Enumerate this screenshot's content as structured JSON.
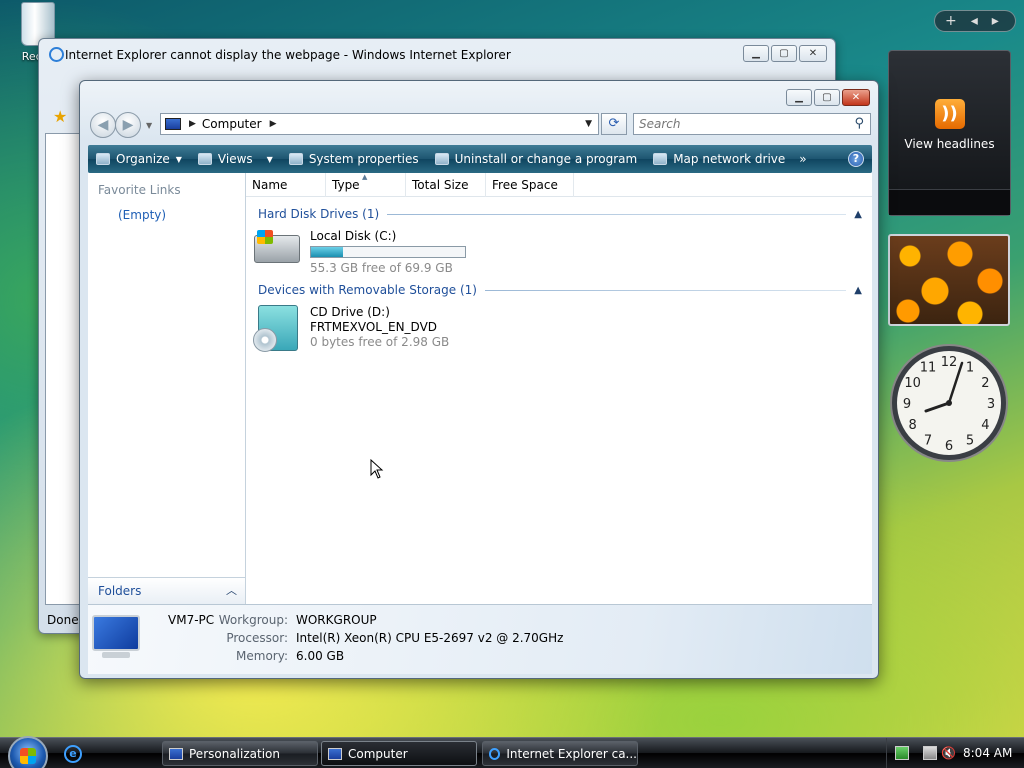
{
  "desktop": {
    "recycle_bin_label": "Recyc"
  },
  "sidebar": {
    "controls": [
      "+",
      "◂",
      "▸"
    ],
    "feed_gadget_label": "View headlines",
    "clock_numbers": [
      "12",
      "1",
      "2",
      "3",
      "4",
      "5",
      "6",
      "7",
      "8",
      "9",
      "10",
      "11"
    ]
  },
  "ie_window": {
    "title": "Internet Explorer cannot display the webpage - Windows Internet Explorer",
    "status": "Done"
  },
  "explorer": {
    "address": "Computer",
    "search_placeholder": "Search",
    "commands": [
      "Organize",
      "Views",
      "System properties",
      "Uninstall or change a program",
      "Map network drive"
    ],
    "more": "»",
    "help": "?",
    "favorite_links": "Favorite Links",
    "favorite_empty": "(Empty)",
    "folders": "Folders",
    "columns": [
      "Name",
      "Type",
      "Total Size",
      "Free Space"
    ],
    "groups": [
      {
        "title": "Hard Disk Drives (1)",
        "drive_name": "Local Disk (C:)",
        "drive_space": "55.3 GB free of 69.9 GB",
        "used_fraction": 0.21
      },
      {
        "title": "Devices with Removable Storage (1)",
        "drive_name": "CD Drive (D:)",
        "drive_label": "FRTMEXVOL_EN_DVD",
        "drive_space": "0 bytes free of 2.98 GB"
      }
    ],
    "details": {
      "pc_name": "VM7-PC",
      "workgroup_label": "Workgroup:",
      "workgroup_value": "WORKGROUP",
      "processor_label": "Processor:",
      "processor_value": "Intel(R) Xeon(R) CPU E5-2697 v2 @ 2.70GHz",
      "memory_label": "Memory:",
      "memory_value": "6.00 GB"
    }
  },
  "taskbar": {
    "buttons": [
      "Personalization",
      "Computer",
      "Internet Explorer ca..."
    ],
    "clock": "8:04 AM"
  }
}
